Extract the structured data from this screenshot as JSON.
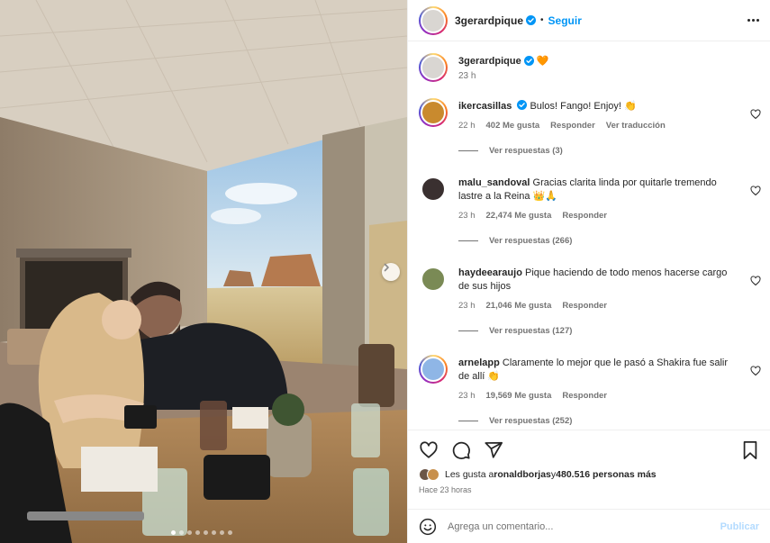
{
  "post": {
    "author": "3gerardpique",
    "follow_label": "Seguir",
    "separator": "•",
    "caption_time": "23 h",
    "caption_emoji": "🧡"
  },
  "comments": [
    {
      "username": "ikercasillas",
      "verified": true,
      "text": "Bulos! Fango! Enjoy! 👏",
      "time": "22 h",
      "likes": "402 Me gusta",
      "reply_label": "Responder",
      "translate_label": "Ver traducción",
      "replies": "Ver respuestas (3)"
    },
    {
      "username": "malu_sandoval",
      "verified": false,
      "text": "Gracias clarita linda por quitarle tremendo lastre a la Reina 👑🙏",
      "time": "23 h",
      "likes": "22,474 Me gusta",
      "reply_label": "Responder",
      "replies": "Ver respuestas (266)"
    },
    {
      "username": "haydeearaujo",
      "verified": false,
      "text": "Pique haciendo de todo menos hacerse cargo de sus hijos",
      "time": "23 h",
      "likes": "21,046 Me gusta",
      "reply_label": "Responder",
      "replies": "Ver respuestas (127)"
    },
    {
      "username": "arnelapp",
      "verified": false,
      "text": "Claramente lo mejor que le pasó a Shakira fue salir de allí 👏",
      "time": "23 h",
      "likes": "19,569 Me gusta",
      "reply_label": "Responder",
      "replies": "Ver respuestas (252)"
    }
  ],
  "likes_summary": {
    "prefix": "Les gusta a ",
    "user": "ronaldborjas",
    "middle": " y ",
    "count": "480.516 personas más"
  },
  "posted_ago": "Hace 23 horas",
  "comment_box": {
    "placeholder": "Agrega un comentario...",
    "publish_label": "Publicar"
  },
  "carousel": {
    "slides": 8,
    "active_index": 0
  },
  "colors": {
    "accent": "#0095f6",
    "verified": "#0095f6",
    "text": "#262626",
    "muted": "#737373",
    "publish_disabled": "#b3dbff"
  },
  "icons": [
    "verified-badge-icon",
    "more-options-icon",
    "heart-icon",
    "comment-icon",
    "share-icon",
    "bookmark-icon",
    "emoji-icon",
    "chevron-right-icon"
  ]
}
